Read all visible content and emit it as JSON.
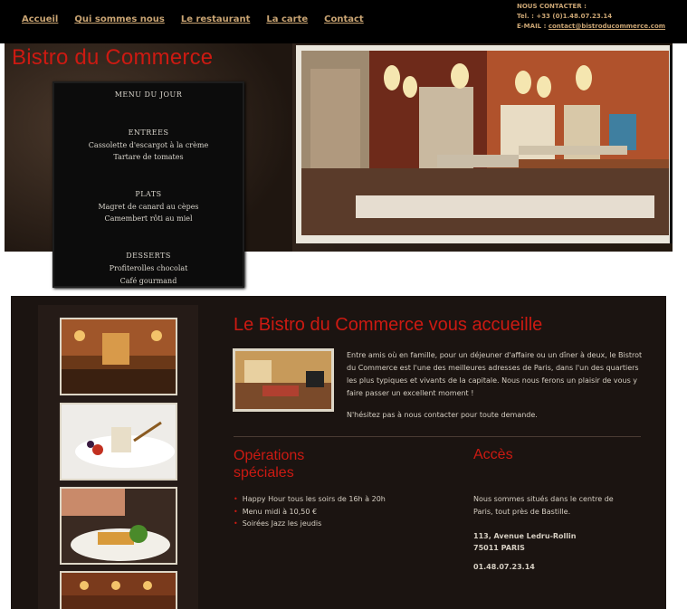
{
  "nav": {
    "items": [
      "Accueil",
      "Qui sommes nous",
      "Le restaurant",
      "La carte",
      "Contact"
    ]
  },
  "contact": {
    "heading": "NOUS CONTACTER :",
    "tel": "Tel. : +33 (0)1.48.07.23.14",
    "email_label": "E-MAIL : ",
    "email": "contact@bistroducommerce.com"
  },
  "hero": {
    "title": "Bistro du Commerce"
  },
  "menu_board": {
    "title": "MENU DU JOUR",
    "sections": [
      {
        "heading": "ENTREES",
        "items": [
          "Cassolette d'escargot à la crème",
          "Tartare de tomates"
        ]
      },
      {
        "heading": "PLATS",
        "items": [
          "Magret de canard au cèpes",
          "Camembert rôti au miel"
        ]
      },
      {
        "heading": "DESSERTS",
        "items": [
          "Profiterolles chocolat",
          "Café gourmand"
        ]
      }
    ]
  },
  "welcome": {
    "title": "Le Bistro du Commerce vous accueille",
    "text": "Entre amis où en famille, pour un déjeuner d'affaire ou un dîner à deux, le Bistrot du Commerce est l'une des meilleures adresses de Paris, dans l'un des quartiers les plus typiques et vivants de la capitale. Nous nous ferons un plaisir de vous y faire passer un excellent moment !",
    "cta": "N'hésitez pas à nous contacter pour toute demande."
  },
  "operations": {
    "title": "Opérations spéciales",
    "items": [
      "Happy Hour tous les soirs de 16h à 20h",
      "Menu midi à 10,50 €",
      "Soirées Jazz les jeudis"
    ]
  },
  "acces": {
    "title": "Accès",
    "text": "Nous sommes situés dans le centre de Paris, tout près de Bastille.",
    "address_line1": "113, Avenue Ledru-Rollin",
    "address_line2": "75011 PARIS",
    "phone": "01.48.07.23.14"
  },
  "colors": {
    "accent_red": "#cc1a12",
    "nav_gold": "#c9a473",
    "background_dark": "#1b1411"
  }
}
